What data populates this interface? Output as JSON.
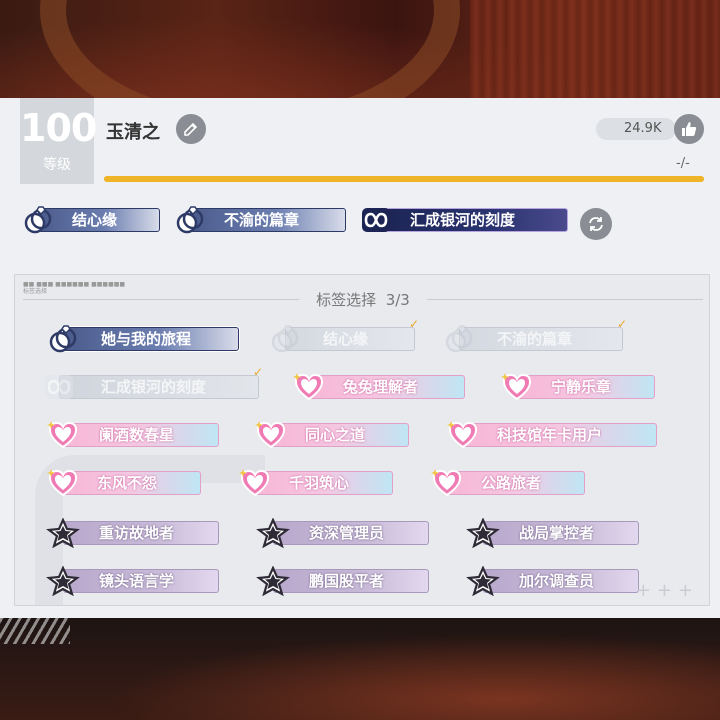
{
  "profile": {
    "level": "100",
    "level_label": "等级",
    "name": "玉清之",
    "likes": "24.9K",
    "progress_text": "-/-"
  },
  "equipped_tags": [
    {
      "label": "结心缘",
      "style": "ring"
    },
    {
      "label": "不渝的篇章",
      "style": "ring"
    },
    {
      "label": "汇成银河的刻度",
      "style": "galaxy"
    }
  ],
  "selector": {
    "title": "标签选择",
    "count": "3/3",
    "mini_header": "■■ ■■■ ■■■■■■ ■■■■■■",
    "mini_sub": "标签选择",
    "tags": [
      {
        "label": "她与我的旅程",
        "style": "ring",
        "state": "active"
      },
      {
        "label": "结心缘",
        "style": "ring",
        "state": "selected"
      },
      {
        "label": "不渝的篇章",
        "style": "ring",
        "state": "selected"
      },
      {
        "label": "汇成银河的刻度",
        "style": "galaxy",
        "state": "selected"
      },
      {
        "label": "兔兔理解者",
        "style": "heart"
      },
      {
        "label": "宁静乐章",
        "style": "heart"
      },
      {
        "label": "阑酒数春星",
        "style": "heart"
      },
      {
        "label": "同心之道",
        "style": "heart"
      },
      {
        "label": "科技馆年卡用户",
        "style": "heart"
      },
      {
        "label": "东风不怨",
        "style": "heart"
      },
      {
        "label": "千羽筑心",
        "style": "heart"
      },
      {
        "label": "公路旅者",
        "style": "heart"
      },
      {
        "label": "重访故地者",
        "style": "star"
      },
      {
        "label": "资深管理员",
        "style": "star"
      },
      {
        "label": "战局掌控者",
        "style": "star"
      },
      {
        "label": "镜头语言学",
        "style": "star"
      },
      {
        "label": "鹏国股平者",
        "style": "star"
      },
      {
        "label": "加尔调查员",
        "style": "star"
      }
    ]
  },
  "colors": {
    "progress": "#f0b429",
    "ring": "#4a5b8c",
    "galaxy": "#1c2454",
    "heart": "#f8b6d6",
    "star": "#b8a8cc",
    "check": "#e8a830"
  },
  "icons": {
    "edit": "edit-icon",
    "like": "thumbs-up-icon",
    "refresh": "refresh-icon"
  }
}
